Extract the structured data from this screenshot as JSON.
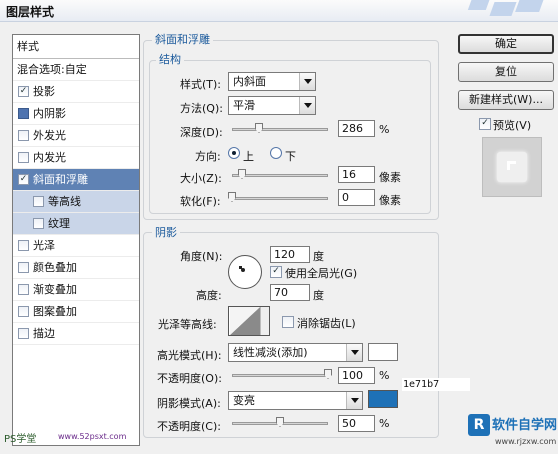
{
  "dialog": {
    "title": "图层样式"
  },
  "sidebar": {
    "header": "样式",
    "blending": "混合选项:自定",
    "items": [
      {
        "label": "投影",
        "checked": true
      },
      {
        "label": "内阴影",
        "checked": false
      },
      {
        "label": "外发光",
        "checked": false
      },
      {
        "label": "内发光",
        "checked": false
      },
      {
        "label": "斜面和浮雕",
        "checked": true
      },
      {
        "label": "等高线",
        "checked": false
      },
      {
        "label": "纹理",
        "checked": false
      },
      {
        "label": "光泽",
        "checked": false
      },
      {
        "label": "颜色叠加",
        "checked": false
      },
      {
        "label": "渐变叠加",
        "checked": false
      },
      {
        "label": "图案叠加",
        "checked": false
      },
      {
        "label": "描边",
        "checked": false
      }
    ],
    "checkmark": "✓"
  },
  "bevel": {
    "group_title": "斜面和浮雕",
    "structure_title": "结构",
    "style": {
      "label": "样式(T):",
      "value": "内斜面"
    },
    "technique": {
      "label": "方法(Q):",
      "value": "平滑"
    },
    "depth": {
      "label": "深度(D):",
      "value": "286",
      "unit": "%",
      "level": 0.28
    },
    "direction": {
      "label": "方向:",
      "up": "上",
      "down": "下",
      "selected": "上"
    },
    "size": {
      "label": "大小(Z):",
      "value": "16",
      "unit": "像素",
      "level": 0.1
    },
    "soften": {
      "label": "软化(F):",
      "value": "0",
      "unit": "像素",
      "level": 0.0
    }
  },
  "shading": {
    "title": "阴影",
    "angle": {
      "label": "角度(N):",
      "value": "120",
      "unit": "度"
    },
    "global_light": "使用全局光(G)",
    "altitude": {
      "label": "高度:",
      "value": "70",
      "unit": "度"
    },
    "gloss_contour": {
      "label": "光泽等高线:"
    },
    "anti_aliased": "消除锯齿(L)",
    "highlight_mode": {
      "label": "高光模式(H):",
      "value": "线性减淡(添加)",
      "color": "#ffffff"
    },
    "highlight_opacity": {
      "label": "不透明度(O):",
      "value": "100",
      "unit": "%",
      "level": 1.0
    },
    "shadow_mode": {
      "label": "阴影模式(A):",
      "value": "变亮",
      "color": "#1e71b7"
    },
    "shadow_opacity": {
      "label": "不透明度(C):",
      "value": "50",
      "unit": "%",
      "level": 0.5
    },
    "hex_note": "1e71b7"
  },
  "buttons": {
    "ok": "确定",
    "reset": "复位",
    "new_style": "新建样式(W)...",
    "preview": "预览(V)"
  },
  "watermarks": {
    "left": "PS学堂",
    "left2": "www.52psxt.com",
    "right": "软件自学网",
    "right_url": "www.rjzxw.com",
    "logo_letter": "R"
  }
}
